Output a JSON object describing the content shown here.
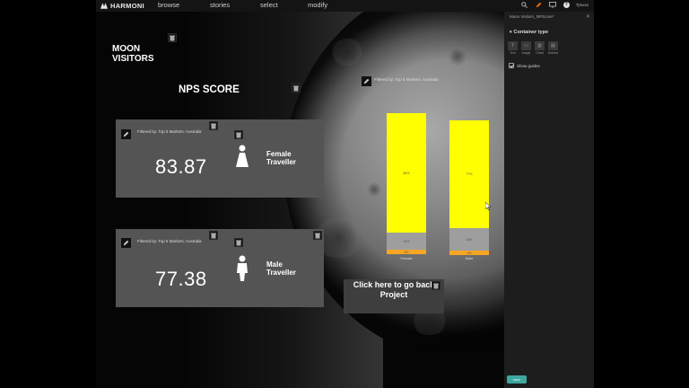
{
  "app": {
    "brand": "HARMONI",
    "nav": [
      "browse",
      "stories",
      "select",
      "modify"
    ],
    "username": "Tjmxxx"
  },
  "canvas": {
    "title": "MOON\nVISITORS",
    "subtitle": "NPS SCORE",
    "filter_text": "Filtered by: Top 5 Markets: Australia",
    "cards": [
      {
        "score": "83.87",
        "gender_label": "Female\nTraveller",
        "icon": "female-person-icon"
      },
      {
        "score": "77.38",
        "gender_label": "Male\nTraveller",
        "icon": "male-person-icon"
      }
    ],
    "back_button": "Click here to go back\nProject"
  },
  "chart_data": {
    "type": "bar",
    "stacked": true,
    "categories": [
      "Female",
      "Male"
    ],
    "series": [
      {
        "name": "",
        "color": "#ffff00",
        "values": [
          84,
          77
        ]
      },
      {
        "name": "",
        "color": "#9e9e9e",
        "values": [
          12,
          16
        ]
      },
      {
        "name": "",
        "color": "#f6a623",
        "values": [
          3,
          3
        ]
      }
    ],
    "data_labels": [
      "84%",
      "12%",
      "3%",
      "77%",
      "16%",
      "3%"
    ],
    "title": "",
    "xlabel": "",
    "ylabel": ""
  },
  "panel": {
    "file_title": "Moon Visitors_NPScore*",
    "section": "Container type",
    "container_types": [
      {
        "label": "Text",
        "icon": "text-icon"
      },
      {
        "label": "Image",
        "icon": "image-icon"
      },
      {
        "label": "Chart",
        "icon": "chart-icon"
      },
      {
        "label": "Embed",
        "icon": "embed-icon"
      }
    ],
    "show_grid_label": "Show guides",
    "save_label": "save"
  },
  "colors": {
    "accent_yellow": "#ffff00",
    "accent_orange": "#f6a623",
    "save_teal": "#3da7a0",
    "card_gray": "#545454"
  }
}
